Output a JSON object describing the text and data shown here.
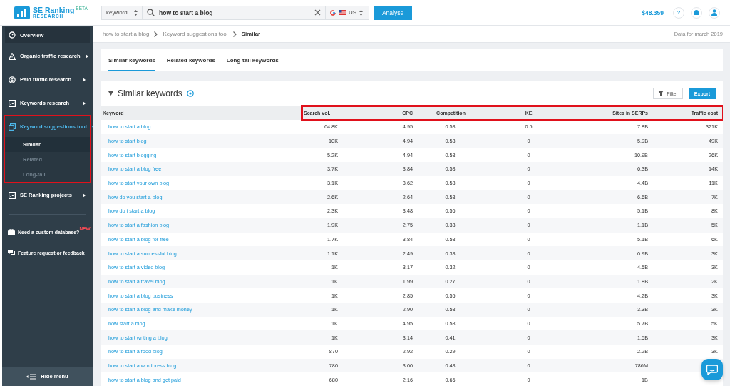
{
  "logo": {
    "name": "SE Ranking",
    "badge": "BETA",
    "sub": "RESEARCH"
  },
  "search": {
    "type": "keyword",
    "query": "how to start a blog",
    "region": "US",
    "button": "Analyse"
  },
  "balance": "$48.359",
  "help": "?",
  "sidebar": {
    "items": [
      {
        "label": "Overview",
        "selected": false,
        "highlighted": false
      },
      {
        "label": "Organic traffic research",
        "arrow": true,
        "expanded": false,
        "selected": false,
        "highlighted": false
      },
      {
        "label": "Paid traffic research",
        "arrow": true,
        "expanded": false,
        "selected": false,
        "highlighted": false
      },
      {
        "label": "Keywords research",
        "arrow": true,
        "expanded": false,
        "selected": false,
        "highlighted": false
      },
      {
        "label": "Keyword suggestions tool",
        "arrow": true,
        "expanded": true,
        "selected": true,
        "highlighted": true,
        "children": [
          {
            "label": "Similar",
            "selected": true
          },
          {
            "label": "Related",
            "selected": false
          },
          {
            "label": "Long-tail",
            "selected": false
          }
        ]
      },
      {
        "label": "SE Ranking projects",
        "arrow": true,
        "expanded": false,
        "selected": false,
        "highlighted": false
      }
    ],
    "extras": [
      {
        "label": "Need a custom database?",
        "badge": "NEW"
      },
      {
        "label": "Feature request or feedback"
      }
    ],
    "hide": "Hide menu"
  },
  "breadcrumb": [
    "how to start a blog",
    "Keyword suggestions tool",
    "Similar"
  ],
  "data_date": "Data for march 2019",
  "tabs": [
    {
      "label": "Similar keywords",
      "selected": true
    },
    {
      "label": "Related keywords",
      "selected": false
    },
    {
      "label": "Long-tail keywords",
      "selected": false
    }
  ],
  "section": {
    "title": "Similar keywords",
    "filter": "Filter",
    "export": "Export"
  },
  "table": {
    "columns_highlighted": true,
    "columns": [
      "Keyword",
      "Search vol.",
      "CPC",
      "Competition",
      "KEI",
      "Sites in SERPs",
      "Traffic cost"
    ],
    "rows": [
      [
        "how to start a blog",
        "64.8K",
        "4.95",
        "0.58",
        "0.5",
        "7.8B",
        "321K"
      ],
      [
        "how to start blog",
        "10K",
        "4.94",
        "0.58",
        "0",
        "5.9B",
        "49K"
      ],
      [
        "how to start blogging",
        "5.2K",
        "4.94",
        "0.58",
        "0",
        "10.9B",
        "26K"
      ],
      [
        "how to start a blog free",
        "3.7K",
        "3.84",
        "0.58",
        "0",
        "6.3B",
        "14K"
      ],
      [
        "how to start your own blog",
        "3.1K",
        "3.62",
        "0.58",
        "0",
        "4.4B",
        "11K"
      ],
      [
        "how do you start a blog",
        "2.6K",
        "2.64",
        "0.53",
        "0",
        "6.6B",
        "7K"
      ],
      [
        "how do i start a blog",
        "2.3K",
        "3.48",
        "0.56",
        "0",
        "5.1B",
        "8K"
      ],
      [
        "how to start a fashion blog",
        "1.9K",
        "2.75",
        "0.33",
        "0",
        "1.1B",
        "5K"
      ],
      [
        "how to start a blog for free",
        "1.7K",
        "3.84",
        "0.58",
        "0",
        "5.1B",
        "6K"
      ],
      [
        "how to start a successful blog",
        "1.1K",
        "2.49",
        "0.33",
        "0",
        "0.9B",
        "3K"
      ],
      [
        "how to start a video blog",
        "1K",
        "3.17",
        "0.32",
        "0",
        "4.5B",
        "3K"
      ],
      [
        "how to start a travel blog",
        "1K",
        "1.99",
        "0.27",
        "0",
        "1.8B",
        "2K"
      ],
      [
        "how to start a blog business",
        "1K",
        "2.85",
        "0.55",
        "0",
        "4.2B",
        "3K"
      ],
      [
        "how to start a blog and make money",
        "1K",
        "2.90",
        "0.58",
        "0",
        "3.3B",
        "3K"
      ],
      [
        "how start a blog",
        "1K",
        "4.95",
        "0.58",
        "0",
        "5.7B",
        "5K"
      ],
      [
        "how to start writing a blog",
        "1K",
        "3.14",
        "0.41",
        "0",
        "1.5B",
        "3K"
      ],
      [
        "how to start a food blog",
        "870",
        "2.92",
        "0.29",
        "0",
        "2.2B",
        "3K"
      ],
      [
        "how to start a wordpress blog",
        "780",
        "3.00",
        "0.48",
        "0",
        "786M",
        null
      ],
      [
        "how to start a blog and get paid",
        "680",
        "2.16",
        "0.66",
        "0",
        "1B",
        null
      ]
    ]
  }
}
